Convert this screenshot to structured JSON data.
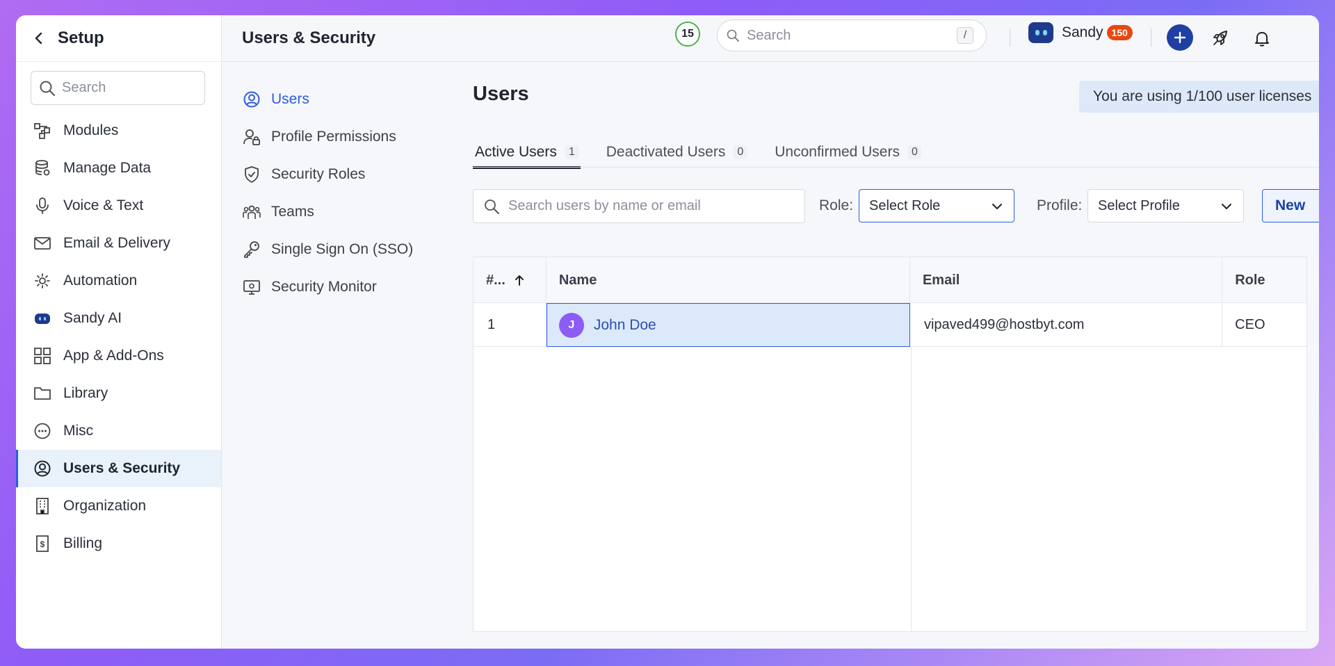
{
  "sidebar": {
    "title": "Setup",
    "search_placeholder": "Search",
    "items": [
      {
        "label": "Modules",
        "icon": "modules-icon"
      },
      {
        "label": "Manage Data",
        "icon": "database-icon"
      },
      {
        "label": "Voice & Text",
        "icon": "microphone-icon"
      },
      {
        "label": "Email & Delivery",
        "icon": "envelope-icon"
      },
      {
        "label": "Automation",
        "icon": "automation-icon"
      },
      {
        "label": "Sandy AI",
        "icon": "robot-icon"
      },
      {
        "label": "App & Add-Ons",
        "icon": "grid-icon"
      },
      {
        "label": "Library",
        "icon": "folder-icon"
      },
      {
        "label": "Misc",
        "icon": "more-circle-icon"
      },
      {
        "label": "Users & Security",
        "icon": "user-circle-icon",
        "active": true
      },
      {
        "label": "Organization",
        "icon": "building-icon"
      },
      {
        "label": "Billing",
        "icon": "billing-icon"
      }
    ]
  },
  "header": {
    "title": "Users & Security",
    "notification_count": "15",
    "search_placeholder": "Search",
    "search_shortcut": "/",
    "assistant_name": "Sandy",
    "assistant_badge": "150",
    "avatar_initial": "J",
    "accent_color": "#1f3fa3"
  },
  "subnav": {
    "items": [
      {
        "label": "Users",
        "icon": "user-circle-icon",
        "active": true
      },
      {
        "label": "Profile Permissions",
        "icon": "user-lock-icon"
      },
      {
        "label": "Security Roles",
        "icon": "shield-check-icon"
      },
      {
        "label": "Teams",
        "icon": "team-icon"
      },
      {
        "label": "Single Sign On (SSO)",
        "icon": "key-icon"
      },
      {
        "label": "Security Monitor",
        "icon": "monitor-icon"
      }
    ]
  },
  "content": {
    "heading": "Users",
    "license_text": "You are using 1/100 user licenses",
    "tabs": [
      {
        "label": "Active Users",
        "count": "1",
        "active": true
      },
      {
        "label": "Deactivated Users",
        "count": "0"
      },
      {
        "label": "Unconfirmed Users",
        "count": "0"
      }
    ],
    "filters": {
      "search_placeholder": "Search users by name or email",
      "role_label": "Role:",
      "role_value": "Select Role",
      "profile_label": "Profile:",
      "profile_value": "Select Profile",
      "new_button": "New"
    },
    "table": {
      "columns": [
        "#...",
        "Name",
        "Email",
        "Role"
      ],
      "rows": [
        {
          "num": "1",
          "initial": "J",
          "name": "John Doe",
          "email": "vipaved499@hostbyt.com",
          "role": "CEO"
        }
      ]
    }
  }
}
